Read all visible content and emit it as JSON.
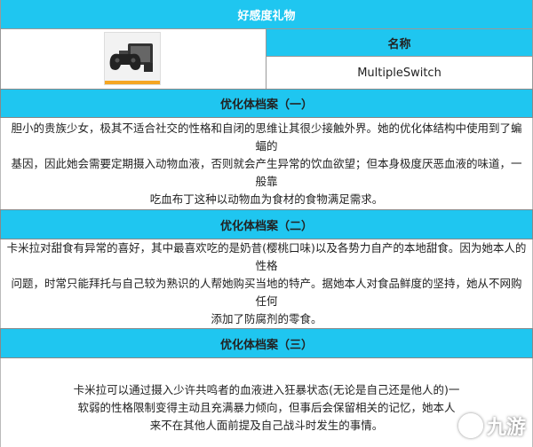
{
  "gift": {
    "header": "好感度礼物",
    "name_header": "名称",
    "name_value": "MultipleSwitch",
    "icon": "game-controller-icon"
  },
  "sections": [
    {
      "title": "优化体档案（一）",
      "lines": [
        "胆小的贵族少女，极其不适合社交的性格和自闭的思维让其很少接触外界。她的优化体结构中使用到了蝙蝠的",
        "基因，因此她会需要定期摄入动物血液，否则就会产生异常的饮血欲望；但本身极度厌恶血液的味道，一般靠",
        "吃血布丁这种以动物血为食材的食物满足需求。"
      ]
    },
    {
      "title": "优化体档案（二）",
      "lines": [
        "卡米拉对甜食有异常的喜好，其中最喜欢吃的是奶昔(樱桃口味)以及各势力自产的本地甜食。因为她本人的性格",
        "问题，时常只能拜托与自己较为熟识的人帮她购买当地的特产。据她本人对食品鲜度的坚持，她从不网购任何",
        "添加了防腐剂的零食。"
      ]
    },
    {
      "title": "优化体档案（三）",
      "lines": [
        "卡米拉可以通过摄入少许共鸣者的血液进入狂暴状态(无论是自己还是他人的)一",
        "软弱的性格限制变得主动且充满暴力倾向，但事后会保留相关的记忆，她本人",
        "来不在其他人面前提及自己战斗时发生的事情。"
      ]
    }
  ],
  "watermark": {
    "text": "九游",
    "icon": "jiuyou-logo-icon"
  }
}
